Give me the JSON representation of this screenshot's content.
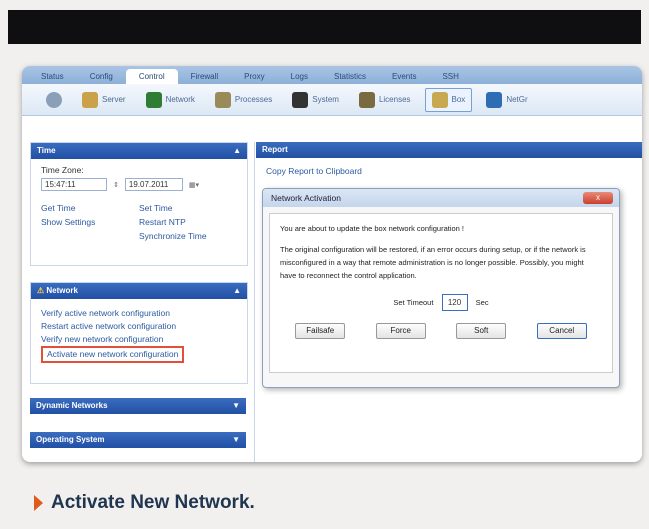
{
  "tabs": [
    "Status",
    "Config",
    "Control",
    "Firewall",
    "Proxy",
    "Logs",
    "Statistics",
    "Events",
    "SSH"
  ],
  "active_tab": 2,
  "toolbar": {
    "items": [
      {
        "label": "Server",
        "icon": "server-icon",
        "color": "#c9a24a"
      },
      {
        "label": "Network",
        "icon": "network-icon",
        "color": "#2e7d32"
      },
      {
        "label": "Processes",
        "icon": "processes-icon",
        "color": "#9a8a5a"
      },
      {
        "label": "System",
        "icon": "system-icon",
        "color": "#333333"
      },
      {
        "label": "Licenses",
        "icon": "licenses-icon",
        "color": "#7a6a40"
      },
      {
        "label": "Box",
        "icon": "box-icon",
        "color": "#c8a850"
      },
      {
        "label": "NetGr",
        "icon": "netgr-icon",
        "color": "#2e6db4"
      }
    ]
  },
  "time_panel": {
    "title": "Time",
    "timezone_label": "Time Zone:",
    "time_value": "15:47:11",
    "date_value": "19.07.2011",
    "links": [
      "Get Time",
      "Set Time",
      "Show Settings",
      "Restart NTP",
      "Synchronize Time"
    ]
  },
  "network_panel": {
    "title": "Network",
    "links": [
      "Verify active network configuration",
      "Restart active network configuration",
      "Verify new network configuration",
      "Activate new network configuration"
    ]
  },
  "dynamic_panel": {
    "title": "Dynamic Networks"
  },
  "os_panel": {
    "title": "Operating System"
  },
  "report": {
    "title": "Report",
    "copy_link": "Copy Report to Clipboard"
  },
  "dialog": {
    "title": "Network Activation",
    "line1": "You are about to update the box network configuration !",
    "line2": "The original configuration will be restored, if an error occurs during setup, or if the network is misconfigured in a way that remote administration is no longer possible. Possibly, you might have to reconnect the control application.",
    "timeout_label": "Set Timeout",
    "timeout_value": "120",
    "timeout_unit": "Sec",
    "buttons": [
      "Failsafe",
      "Force",
      "Soft",
      "Cancel"
    ],
    "close_label": "x"
  },
  "caption": "Activate New Network."
}
